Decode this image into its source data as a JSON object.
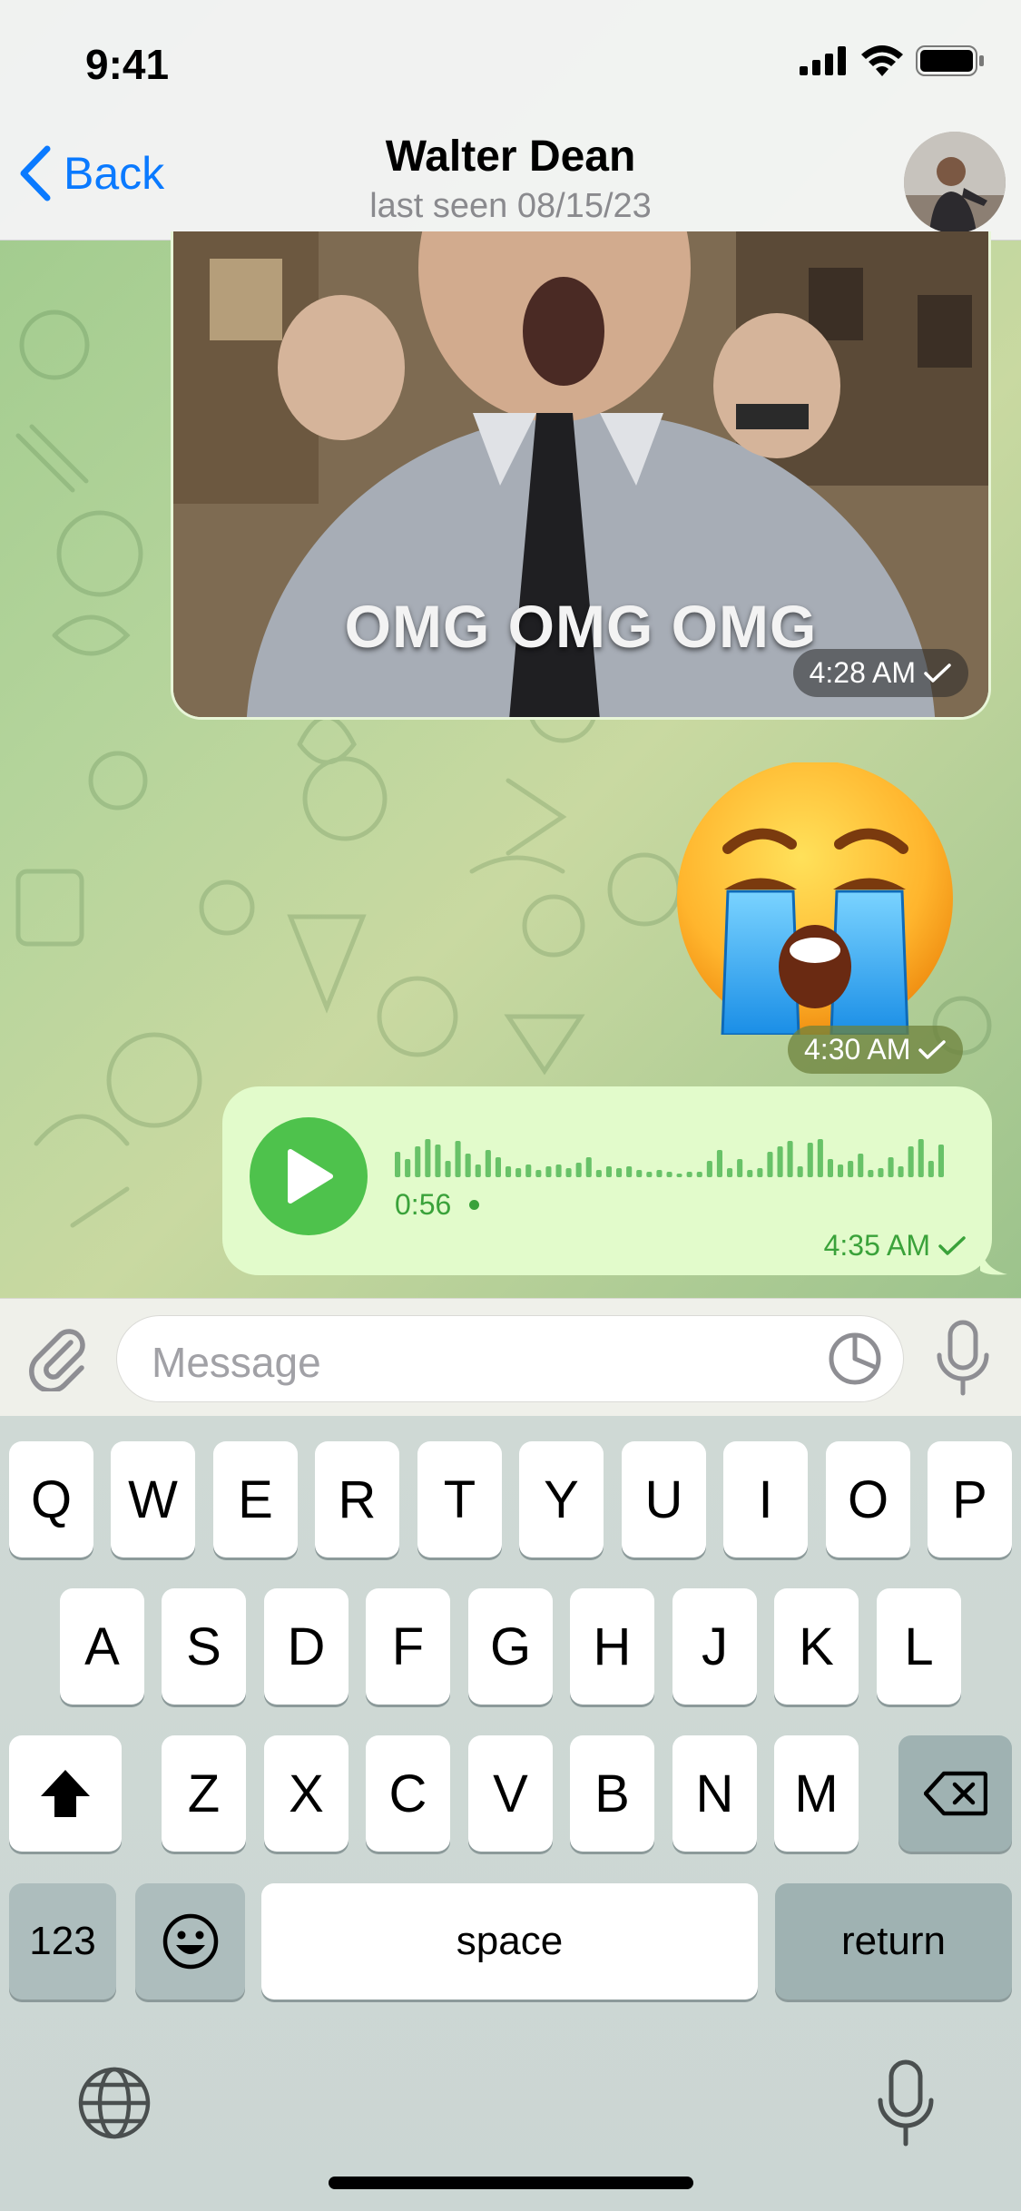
{
  "status_bar": {
    "time": "9:41"
  },
  "header": {
    "back_label": "Back",
    "contact_name": "Walter Dean",
    "last_seen": "last seen 08/15/23"
  },
  "messages": [
    {
      "type": "gif",
      "caption": "OMG OMG OMG",
      "time": "4:28 AM",
      "status": "sent"
    },
    {
      "type": "emoji",
      "emoji_name": "loudly-crying-face",
      "time": "4:30 AM",
      "status": "sent"
    },
    {
      "type": "voice",
      "duration": "0:56",
      "time": "4:35 AM",
      "status": "sent"
    }
  ],
  "input": {
    "placeholder": "Message"
  },
  "keyboard": {
    "row1": [
      "Q",
      "W",
      "E",
      "R",
      "T",
      "Y",
      "U",
      "I",
      "O",
      "P"
    ],
    "row2": [
      "A",
      "S",
      "D",
      "F",
      "G",
      "H",
      "J",
      "K",
      "L"
    ],
    "row3": [
      "Z",
      "X",
      "C",
      "V",
      "B",
      "N",
      "M"
    ],
    "numbers_label": "123",
    "space_label": "space",
    "return_label": "return"
  },
  "colors": {
    "accent_blue": "#0a7aff",
    "outgoing_bubble": "#e2fbcb",
    "voice_green": "#4ec24c"
  }
}
